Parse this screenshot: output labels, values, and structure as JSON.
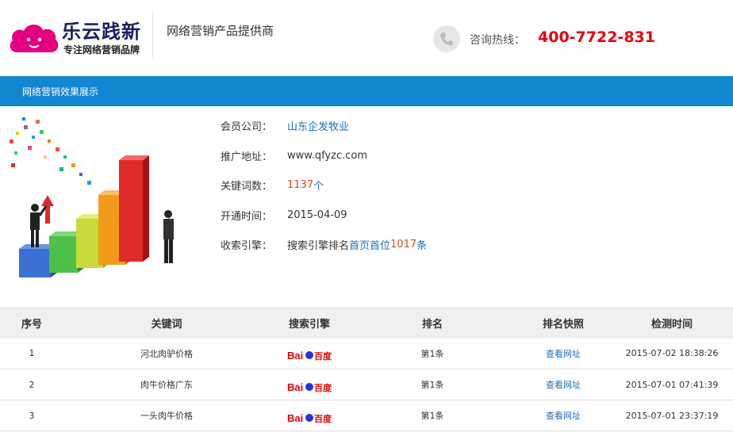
{
  "header": {
    "logo_title": "乐云践新",
    "logo_subtitle": "专注网络营销品牌",
    "tagline": "网络营销产品提供商",
    "hotline_label": "咨询热线：",
    "hotline_number": "400-7722-831",
    "accent_color": "#e60012"
  },
  "section": {
    "title": "网络营销效果展示",
    "bar_color": "#1386d2"
  },
  "info": [
    {
      "label": "会员公司：",
      "value": "山东企发牧业",
      "style": "blue"
    },
    {
      "label": "推广地址：",
      "value": "www.qfyzc.com",
      "style": "plain"
    },
    {
      "label": "关键词数：",
      "value_num": "1137",
      "value_unit": "个"
    },
    {
      "label": "开通时间：",
      "value": "2015-04-09",
      "style": "plain"
    },
    {
      "label": "收索引擎：",
      "prefix": "搜索引擎排名",
      "mid": "首页首位",
      "count": "1017",
      "suffix": "条"
    }
  ],
  "table": {
    "headers": [
      "序号",
      "关键词",
      "搜索引擎",
      "排名",
      "排名快照",
      "检测时间"
    ],
    "rows": [
      {
        "idx": "1",
        "keyword": "河北肉驴价格",
        "engine": "baidu-logo",
        "rank": "第1条",
        "snapshot": "查看网址",
        "time": "2015-07-02 18:38:26"
      },
      {
        "idx": "2",
        "keyword": "肉牛价格广东",
        "engine": "baidu-logo",
        "rank": "第1条",
        "snapshot": "查看网址",
        "time": "2015-07-01 07:41:39"
      },
      {
        "idx": "3",
        "keyword": "一头肉牛价格",
        "engine": "baidu-logo",
        "rank": "第1条",
        "snapshot": "查看网址",
        "time": "2015-07-01 23:37:19"
      }
    ]
  },
  "icons": {
    "phone": "phone-icon",
    "cloud": "cloud-logo-icon"
  }
}
